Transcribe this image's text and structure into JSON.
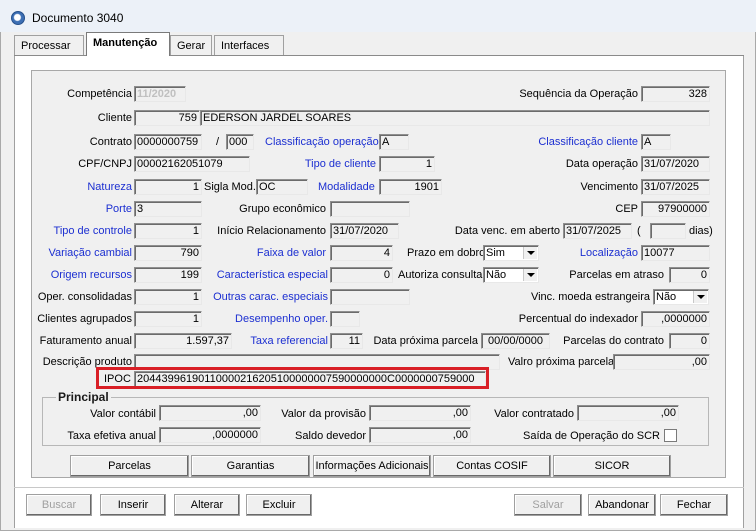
{
  "window": {
    "title": "Documento 3040"
  },
  "tabs": [
    {
      "label": "Processar"
    },
    {
      "label": "Manutenção"
    },
    {
      "label": "Gerar"
    },
    {
      "label": "Interfaces"
    }
  ],
  "form": {
    "competencia": {
      "label": "Competência",
      "value": "11/2020"
    },
    "sequencia": {
      "label": "Sequência da Operação",
      "value": "328"
    },
    "cliente": {
      "label": "Cliente",
      "code": "759",
      "name": "EDERSON JARDEL SOARES"
    },
    "contrato": {
      "label": "Contrato",
      "value": "0000000759",
      "sep": "/",
      "sub": "000"
    },
    "class_operacao": {
      "label": "Classificação operação",
      "value": "A"
    },
    "class_cliente": {
      "label": "Classificação cliente",
      "value": "A"
    },
    "cpf": {
      "label": "CPF/CNPJ",
      "value": "00002162051079"
    },
    "tipo_cliente": {
      "label": "Tipo de cliente",
      "value": "1"
    },
    "data_operacao": {
      "label": "Data operação",
      "value": "31/07/2020"
    },
    "natureza": {
      "label": "Natureza",
      "value": "1"
    },
    "sigla_mod": {
      "label": "Sigla Mod.",
      "value": "OC"
    },
    "modalidade": {
      "label": "Modalidade",
      "value": "1901"
    },
    "vencimento": {
      "label": "Vencimento",
      "value": "31/07/2025"
    },
    "porte": {
      "label": "Porte",
      "value": "3"
    },
    "grupo_economico": {
      "label": "Grupo econômico",
      "value": ""
    },
    "cep": {
      "label": "CEP",
      "value": "97900000"
    },
    "tipo_controle": {
      "label": "Tipo de controle",
      "value": "1"
    },
    "inicio_relacionamento": {
      "label": "Início Relacionamento",
      "value": "31/07/2020"
    },
    "data_venc_aberto": {
      "label": "Data venc. em aberto",
      "value": "31/07/2025",
      "paren_open": "(",
      "extra": "",
      "dias": "dias)"
    },
    "variacao_cambial": {
      "label": "Variação cambial",
      "value": "790"
    },
    "faixa_valor": {
      "label": "Faixa de valor",
      "value": "4"
    },
    "prazo_dobro": {
      "label": "Prazo em dobro",
      "value": "Sim"
    },
    "localizacao": {
      "label": "Localização",
      "value": "10077"
    },
    "origem_recursos": {
      "label": "Origem recursos",
      "value": "199"
    },
    "caracteristica_especial": {
      "label": "Característica especial",
      "value": "0"
    },
    "autoriza_consulta": {
      "label": "Autoriza consulta",
      "value": "Não"
    },
    "parcelas_atraso": {
      "label": "Parcelas em atraso",
      "value": "0"
    },
    "oper_consolidadas": {
      "label": "Oper. consolidadas",
      "value": "1"
    },
    "outras_carac": {
      "label": "Outras carac. especiais",
      "value": ""
    },
    "vinc_moeda": {
      "label": "Vinc. moeda estrangeira",
      "value": "Não"
    },
    "clientes_agrupados": {
      "label": "Clientes agrupados",
      "value": "1"
    },
    "desempenho_oper": {
      "label": "Desempenho oper.",
      "value": ""
    },
    "percentual_indexador": {
      "label": "Percentual do indexador",
      "value": ",0000000"
    },
    "faturamento_anual": {
      "label": "Faturamento anual",
      "value": "1.597,37"
    },
    "taxa_referencial": {
      "label": "Taxa referencial",
      "value": "11"
    },
    "data_proxima_parcela": {
      "label": "Data próxima parcela",
      "value": "00/00/0000"
    },
    "parcelas_contrato": {
      "label": "Parcelas do contrato",
      "value": "0"
    },
    "descricao_produto": {
      "label": "Descrição produto",
      "value": ""
    },
    "valor_proxima_parcela": {
      "label": "Valro próxima parcela",
      "value": ",00"
    },
    "ipoc": {
      "label": "IPOC",
      "value": "20443996190110000216205100000007590000000C0000000759000"
    }
  },
  "principal": {
    "title": "Principal",
    "valor_contabil": {
      "label": "Valor contábil",
      "value": ",00"
    },
    "valor_provisao": {
      "label": "Valor da provisão",
      "value": ",00"
    },
    "valor_contratado": {
      "label": "Valor contratado",
      "value": ",00"
    },
    "taxa_efetiva": {
      "label": "Taxa efetiva anual",
      "value": ",0000000"
    },
    "saldo_devedor": {
      "label": "Saldo devedor",
      "value": ",00"
    },
    "saida_operacao": {
      "label": "Saída de Operação do SCR"
    }
  },
  "actions": {
    "parcelas": "Parcelas",
    "garantias": "Garantias",
    "informacoes": "Informações Adicionais",
    "cosif": "Contas COSIF",
    "sicor": "SICOR"
  },
  "bottom": {
    "buscar": "Buscar",
    "inserir": "Inserir",
    "alterar": "Alterar",
    "excluir": "Excluir",
    "salvar": "Salvar",
    "abandonar": "Abandonar",
    "fechar": "Fechar"
  }
}
